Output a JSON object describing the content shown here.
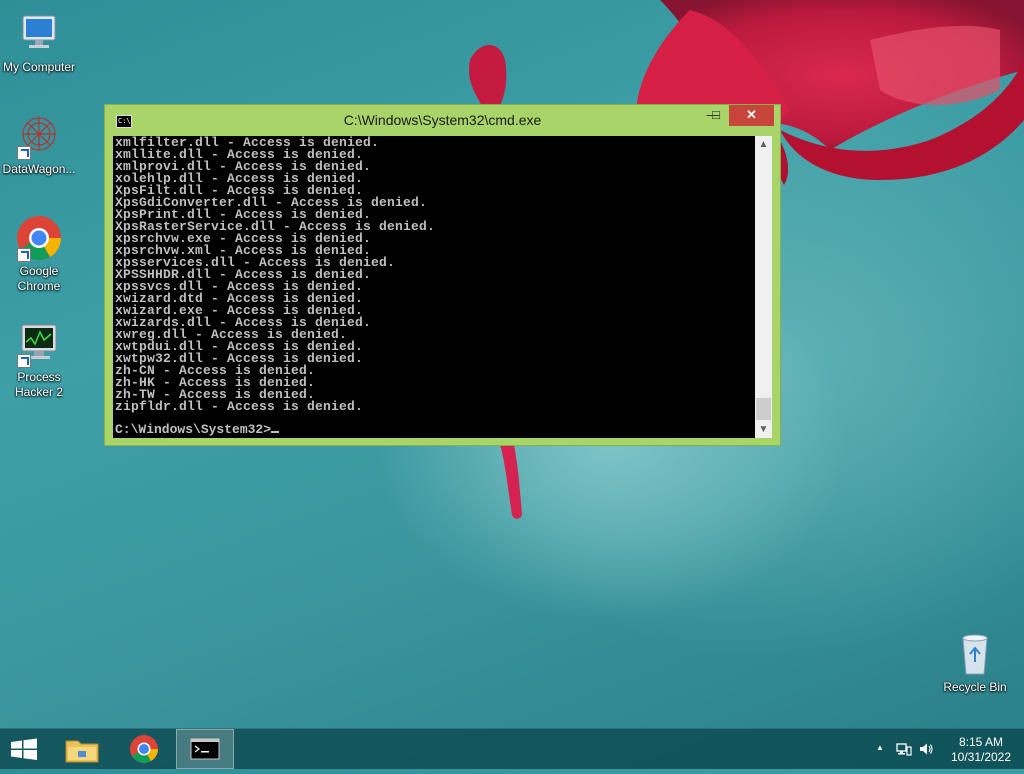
{
  "desktop": {
    "icons": [
      {
        "label": "My Computer"
      },
      {
        "label": "DataWagon..."
      },
      {
        "label": "Google Chrome"
      },
      {
        "label": "Process Hacker 2"
      },
      {
        "label": "Recycle Bin"
      }
    ]
  },
  "window": {
    "title": "C:\\Windows\\System32\\cmd.exe",
    "icon_text": "C:\\",
    "minimize_glyph": "—",
    "maximize_glyph": "□",
    "close_glyph": "✕",
    "console_lines": [
      "xmlfilter.dll - Access is denied.",
      "xmllite.dll - Access is denied.",
      "xmlprovi.dll - Access is denied.",
      "xolehlp.dll - Access is denied.",
      "XpsFilt.dll - Access is denied.",
      "XpsGdiConverter.dll - Access is denied.",
      "XpsPrint.dll - Access is denied.",
      "XpsRasterService.dll - Access is denied.",
      "xpsrchvw.exe - Access is denied.",
      "xpsrchvw.xml - Access is denied.",
      "xpsservices.dll - Access is denied.",
      "XPSSHHDR.dll - Access is denied.",
      "xpssvcs.dll - Access is denied.",
      "xwizard.dtd - Access is denied.",
      "xwizard.exe - Access is denied.",
      "xwizards.dll - Access is denied.",
      "xwreg.dll - Access is denied.",
      "xwtpdui.dll - Access is denied.",
      "xwtpw32.dll - Access is denied.",
      "zh-CN - Access is denied.",
      "zh-HK - Access is denied.",
      "zh-TW - Access is denied.",
      "zipfldr.dll - Access is denied."
    ],
    "prompt": "C:\\Windows\\System32>",
    "scroll_up": "▲",
    "scroll_down": "▼"
  },
  "taskbar": {
    "items": [
      "start-button",
      "file-explorer",
      "google-chrome",
      "command-prompt"
    ],
    "tray_arrow": "▲",
    "time": "8:15 AM",
    "date": "10/31/2022"
  },
  "colors": {
    "window_frame": "#a8d46a",
    "close_button": "#c7453a",
    "console_bg": "#000000",
    "console_text": "#c0c0c0"
  }
}
